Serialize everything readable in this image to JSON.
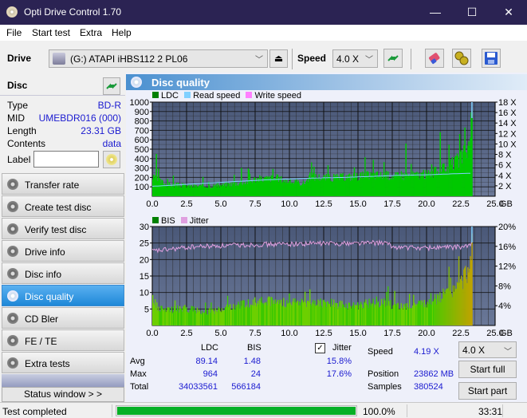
{
  "window": {
    "title": "Opti Drive Control 1.70",
    "minimize": "—",
    "maximize": "☐",
    "close": "✕"
  },
  "menu": [
    "File",
    "Start test",
    "Extra",
    "Help"
  ],
  "toolbar": {
    "drive_label": "Drive",
    "drive_value": "(G:)  ATAPI iHBS112  2 PL06",
    "speed_label": "Speed",
    "speed_value": "4.0 X",
    "icons": [
      "eject-icon",
      "refresh-icon",
      "erase-icon",
      "settings-icon",
      "save-icon"
    ]
  },
  "disc": {
    "header": "Disc",
    "rows": [
      {
        "key": "Type",
        "value": "BD-R"
      },
      {
        "key": "MID",
        "value": "UMEBDR016 (000)"
      },
      {
        "key": "Length",
        "value": "23.31 GB"
      },
      {
        "key": "Contents",
        "value": "data"
      }
    ],
    "label_key": "Label",
    "label_value": ""
  },
  "nav": [
    {
      "label": "Transfer rate",
      "active": false
    },
    {
      "label": "Create test disc",
      "active": false
    },
    {
      "label": "Verify test disc",
      "active": false
    },
    {
      "label": "Drive info",
      "active": false
    },
    {
      "label": "Disc info",
      "active": false
    },
    {
      "label": "Disc quality",
      "active": true
    },
    {
      "label": "CD Bler",
      "active": false
    },
    {
      "label": "FE / TE",
      "active": false
    },
    {
      "label": "Extra tests",
      "active": false
    }
  ],
  "status_window_button": "Status window > >",
  "panel_title": "Disc quality",
  "colors": {
    "ldc": "#008000",
    "read_speed": "#80d0ff",
    "write_speed": "#ff80ff",
    "bis": "#008000",
    "jitter": "#e0a0e0",
    "plot_bg_top": "#4a5878",
    "plot_bg_bottom": "#6a7898",
    "bar_green": "#00c800",
    "progress": "#06b025"
  },
  "chart_data": [
    {
      "type": "area",
      "title": "LDC / Read speed",
      "legend": [
        "LDC",
        "Read speed",
        "Write speed"
      ],
      "legend_position": "top-left",
      "xlabel": "GB",
      "x_ticks": [
        "0.0",
        "2.5",
        "5.0",
        "7.5",
        "10.0",
        "12.5",
        "15.0",
        "17.5",
        "20.0",
        "22.5",
        "25.0"
      ],
      "xlim": [
        0,
        25
      ],
      "y_ticks": [
        "100",
        "200",
        "300",
        "400",
        "500",
        "600",
        "700",
        "800",
        "900",
        "1000"
      ],
      "ylim": [
        0,
        1000
      ],
      "y2_ticks": [
        "2 X",
        "4 X",
        "6 X",
        "8 X",
        "10 X",
        "12 X",
        "14 X",
        "16 X",
        "18 X"
      ],
      "y2lim": [
        0,
        18
      ],
      "grid": true,
      "series": [
        {
          "name": "LDC",
          "x": [
            0,
            0.3,
            0.6,
            1,
            2,
            3,
            4,
            5,
            6,
            7,
            7.5,
            8,
            9,
            10,
            11,
            11.5,
            12,
            13,
            14,
            15,
            16,
            17,
            17.5,
            18,
            19,
            20,
            21,
            21.5,
            22,
            22.5,
            23,
            23.2,
            23.31
          ],
          "y": [
            200,
            180,
            160,
            130,
            120,
            110,
            110,
            120,
            140,
            160,
            190,
            190,
            200,
            160,
            140,
            220,
            210,
            200,
            210,
            220,
            230,
            230,
            220,
            220,
            230,
            240,
            280,
            320,
            360,
            420,
            520,
            700,
            940
          ]
        },
        {
          "name": "Read speed",
          "x": [
            0,
            2,
            4,
            6,
            8,
            10,
            12,
            14,
            16,
            18,
            20,
            22,
            23.31
          ],
          "y": [
            1.9,
            2.2,
            2.5,
            2.8,
            3.1,
            3.3,
            3.5,
            3.6,
            3.8,
            4.0,
            4.1,
            4.3,
            4.4
          ]
        }
      ],
      "peaks": [
        {
          "x": 0.3,
          "y": 450
        },
        {
          "x": 6.5,
          "y": 300
        },
        {
          "x": 8.8,
          "y": 290
        },
        {
          "x": 18.5,
          "y": 560
        },
        {
          "x": 21.0,
          "y": 680
        },
        {
          "x": 22.8,
          "y": 730
        }
      ]
    },
    {
      "type": "bar",
      "title": "BIS / Jitter",
      "legend": [
        "BIS",
        "Jitter"
      ],
      "legend_position": "top-left",
      "xlabel": "GB",
      "x_ticks": [
        "0.0",
        "2.5",
        "5.0",
        "7.5",
        "10.0",
        "12.5",
        "15.0",
        "17.5",
        "20.0",
        "22.5",
        "25.0"
      ],
      "xlim": [
        0,
        25
      ],
      "y_ticks": [
        "5",
        "10",
        "15",
        "20",
        "25",
        "30"
      ],
      "ylim": [
        0,
        30
      ],
      "y2_ticks": [
        "4%",
        "8%",
        "12%",
        "16%",
        "20%"
      ],
      "y2lim": [
        0,
        20
      ],
      "grid": true,
      "series": [
        {
          "name": "BIS",
          "x": [
            0,
            1,
            2,
            3,
            4,
            5,
            6,
            7,
            8,
            9,
            10,
            11,
            12,
            13,
            14,
            15,
            16,
            17,
            18,
            19,
            20,
            21,
            21.5,
            22,
            22.5,
            23,
            23.31
          ],
          "y": [
            6,
            5,
            5,
            5,
            4,
            5,
            6,
            7,
            8,
            7,
            7,
            7,
            7,
            7,
            6,
            6,
            7,
            7,
            6,
            6,
            7,
            9,
            10,
            11,
            13,
            17,
            24
          ]
        },
        {
          "name": "Jitter",
          "x": [
            0,
            1,
            2,
            3,
            4,
            5,
            6,
            7,
            8,
            9,
            10,
            11,
            12,
            13,
            14,
            15,
            16,
            17,
            17.5,
            18,
            19,
            20,
            21,
            22,
            23,
            23.31
          ],
          "y": [
            15.0,
            15.3,
            15.6,
            15.9,
            16.0,
            16.1,
            16.2,
            16.3,
            16.4,
            16.4,
            16.5,
            16.5,
            16.6,
            16.6,
            16.6,
            16.7,
            16.7,
            16.7,
            15.9,
            15.8,
            15.7,
            15.7,
            15.8,
            15.8,
            16.0,
            16.6
          ]
        }
      ]
    }
  ],
  "stats": {
    "headers": [
      "LDC",
      "BIS"
    ],
    "rows": [
      {
        "label": "Avg",
        "ldc": "89.14",
        "bis": "1.48",
        "jitter": "15.8%"
      },
      {
        "label": "Max",
        "ldc": "964",
        "bis": "24",
        "jitter": "17.6%"
      },
      {
        "label": "Total",
        "ldc": "34033561",
        "bis": "566184",
        "jitter": ""
      }
    ],
    "jitter_label": "Jitter",
    "jitter_checked": true,
    "speed_label": "Speed",
    "speed_value": "4.19 X",
    "position_label": "Position",
    "position_value": "23862 MB",
    "samples_label": "Samples",
    "samples_value": "380524",
    "speed_select": "4.0 X",
    "start_full": "Start full",
    "start_part": "Start part"
  },
  "status": {
    "text": "Test completed",
    "progress_percent": 100,
    "progress_label": "100.0%",
    "time": "33:31"
  }
}
